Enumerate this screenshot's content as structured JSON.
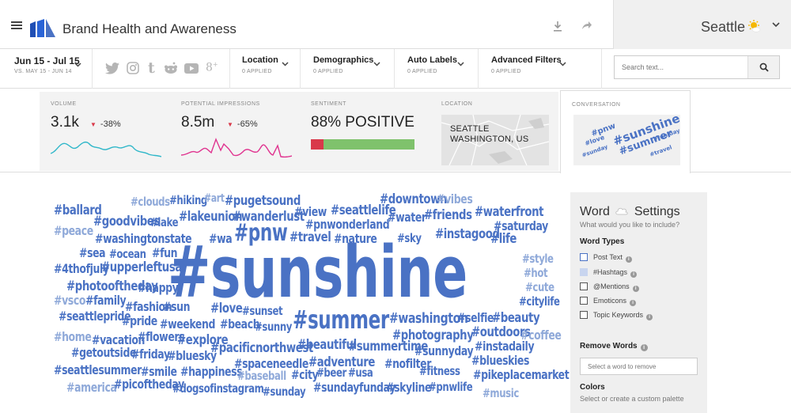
{
  "header": {
    "title": "Brand Health and Awareness",
    "city": "Seattle",
    "icons": [
      "menu-icon",
      "brand-logo",
      "download-icon",
      "share-icon",
      "sun-icon",
      "chevron-down-icon"
    ]
  },
  "filters": {
    "date_range": "Jun 15 - Jul 15",
    "date_compare": "VS. MAY 15 - JUN 14",
    "social_icons": [
      "twitter-icon",
      "instagram-icon",
      "tumblr-icon",
      "reddit-icon",
      "youtube-icon",
      "google-plus-icon"
    ],
    "items": [
      {
        "label": "Location",
        "sub": "0 APPLIED"
      },
      {
        "label": "Demographics",
        "sub": "0 APPLIED"
      },
      {
        "label": "Auto Labels",
        "sub": "0 APPLIED"
      },
      {
        "label": "Advanced Filters",
        "sub": "0 APPLIED"
      }
    ],
    "search_placeholder": "Search text..."
  },
  "metrics": {
    "volume": {
      "label": "VOLUME",
      "value": "3.1k",
      "change": "-38%"
    },
    "impressions": {
      "label": "POTENTIAL IMPRESSIONS",
      "value": "8.5m",
      "change": "-65%"
    },
    "sentiment": {
      "label": "SENTIMENT",
      "value": "88% POSITIVE",
      "positive_fraction": 0.88
    },
    "location": {
      "label": "LOCATION",
      "line1": "SEATTLE",
      "line2": "WASHINGTON, US"
    },
    "conversation": {
      "label": "CONVERSATION"
    }
  },
  "colors": {
    "accent": "#4a72c4",
    "negative": "#d9394a",
    "positive": "#7fc26c",
    "volume_line": "#2fb7c9",
    "impressions_line": "#e0338f"
  },
  "word_cloud": [
    "#sunshine",
    "#pnw",
    "#summer",
    "#ballard",
    "#clouds",
    "#hiking",
    "#art",
    "#pugetsound",
    "#downtown",
    "#vibes",
    "#goodvibes",
    "#lake",
    "#lakeunion",
    "#wanderlust",
    "#view",
    "#seattlelife",
    "#water",
    "#friends",
    "#waterfront",
    "#pnwonderland",
    "#saturday",
    "#peace",
    "#washingtonstate",
    "#wa",
    "#travel",
    "#nature",
    "#sky",
    "#instagood",
    "#life",
    "#sea",
    "#ocean",
    "#fun",
    "#style",
    "#4thofjuly",
    "#upperleftusa",
    "#hot",
    "#photooftheday",
    "#happy",
    "#cute",
    "#vsco",
    "#family",
    "#fashion",
    "#sun",
    "#citylife",
    "#love",
    "#sunset",
    "#seattlepride",
    "#pride",
    "#weekend",
    "#beach",
    "#sunny",
    "#washington",
    "#selfie",
    "#beauty",
    "#home",
    "#vacation",
    "#flowers",
    "#explore",
    "#photography",
    "#outdoors",
    "#coffee",
    "#getoutside",
    "#friday",
    "#bluesky",
    "#pacificnorthwest",
    "#beautiful",
    "#summertime",
    "#sunnyday",
    "#instadaily",
    "#spaceneedle",
    "#adventure",
    "#nofilter",
    "#blueskies",
    "#seattlesummer",
    "#smile",
    "#happiness",
    "#baseball",
    "#city",
    "#beer",
    "#usa",
    "#fitness",
    "#pikeplacemarket",
    "#america",
    "#picoftheday",
    "#dogsofinstagram",
    "#sunday",
    "#sundayfunday",
    "#skyline",
    "#pnwlife",
    "#music"
  ],
  "mini_cloud": [
    "#sunshine",
    "#pnw",
    "#summer",
    "#love",
    "#sunday",
    "#fun day",
    "#travel"
  ],
  "settings": {
    "title_word": "Word",
    "title_rest": "Settings",
    "subtitle": "What would you like to include?",
    "word_types_heading": "Word Types",
    "word_types": [
      "Post Text",
      "#Hashtags",
      "@Mentions",
      "Emoticons",
      "Topic Keywords"
    ],
    "remove_heading": "Remove Words",
    "remove_placeholder": "Select a word to remove",
    "colors_heading": "Colors",
    "colors_sub": "Select or create a custom palette"
  }
}
